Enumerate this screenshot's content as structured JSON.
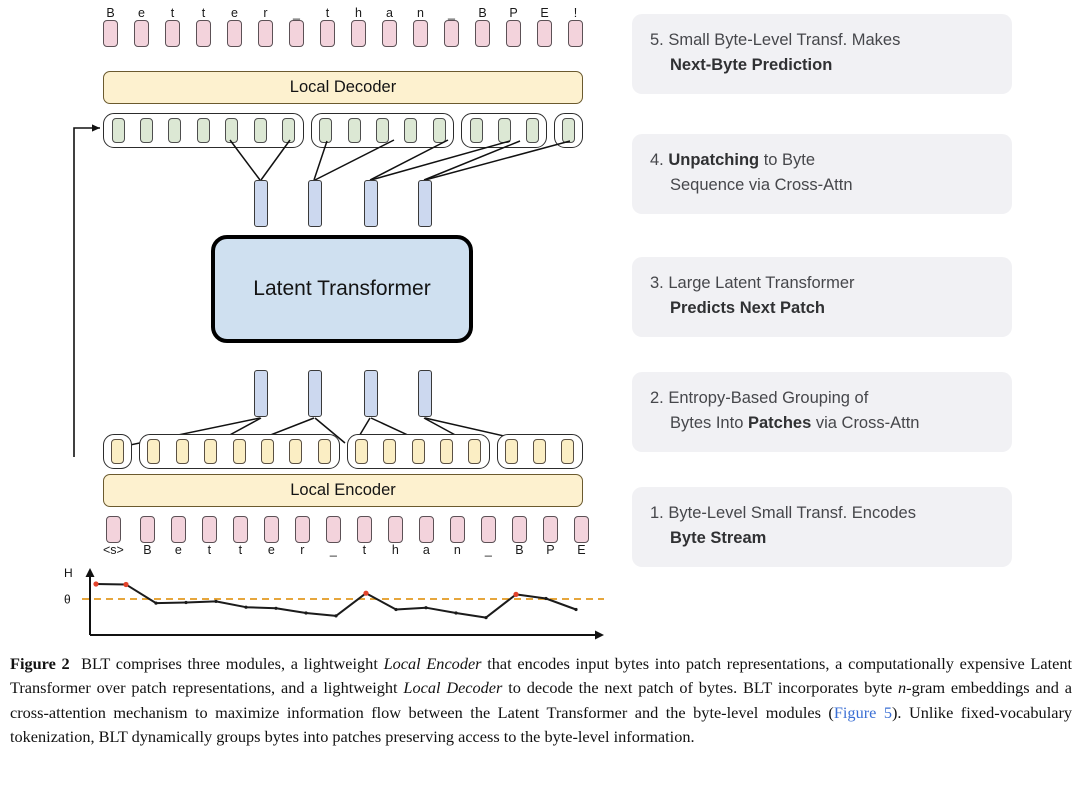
{
  "figure": {
    "label": "Figure 2",
    "caption_text": "BLT comprises three modules, a lightweight Local Encoder that encodes input bytes into patch representations, a computationally expensive Latent Transformer over patch representations, and a lightweight Local Decoder to decode the next patch of bytes. BLT incorporates byte n-gram embeddings and a cross-attention mechanism to maximize information flow between the Latent Transformer and the byte-level modules (Figure 5). Unlike fixed-vocabulary tokenization, BLT dynamically groups bytes into patches preserving access to the byte-level information.",
    "caption_parts": {
      "p1": "BLT comprises three modules, a lightweight ",
      "i1": "Local Encoder",
      "p2": " that encodes input bytes into patch representations, a computationally expensive Latent Transformer over patch representations, and a lightweight ",
      "i2": "Local Decoder",
      "p3": " to decode the next patch of bytes. BLT incorporates byte ",
      "i3": "n",
      "p4": "-gram embeddings and a cross-attention mechanism to maximize information flow between the Latent Transformer and the byte-level modules (",
      "link": "Figure 5",
      "p5": "). Unlike fixed-vocabulary tokenization, BLT dynamically groups bytes into patches preserving access to the byte-level information."
    }
  },
  "modules": {
    "local_decoder": "Local Decoder",
    "latent_transformer": "Latent Transformer",
    "local_encoder": "Local Encoder"
  },
  "output_bytes": {
    "labels": [
      "B",
      "e",
      "t",
      "t",
      "e",
      "r",
      "_",
      "t",
      "h",
      "a",
      "n",
      "_",
      "B",
      "P",
      "E",
      "!"
    ],
    "count": 16,
    "color": "#f3d3dc"
  },
  "input_bytes": {
    "labels": [
      "<s>",
      "B",
      "e",
      "t",
      "t",
      "e",
      "r",
      "_",
      "t",
      "h",
      "a",
      "n",
      "_",
      "B",
      "P",
      "E"
    ],
    "count": 16,
    "color": "#f3d3dc"
  },
  "decoder_patches": {
    "group_sizes": [
      7,
      5,
      3,
      1
    ],
    "color": "#dce8d4"
  },
  "encoder_patches": {
    "group_sizes": [
      1,
      7,
      5,
      3
    ],
    "color": "#fbeec4"
  },
  "patch_vectors": {
    "count_top": 4,
    "count_bottom": 4,
    "color": "#ccd8ef"
  },
  "steps": [
    {
      "number": "5.",
      "line1_plain": "Small Byte-Level Transf. Makes",
      "line2_bold": "Next-Byte Prediction"
    },
    {
      "number": "4.",
      "line1_bold": "Unpatching",
      "line1_plain": " to Byte",
      "line2_plain": "Sequence via Cross-Attn"
    },
    {
      "number": "3.",
      "line1_plain": "Large Latent Transformer",
      "line2_bold": "Predicts Next Patch"
    },
    {
      "number": "2.",
      "line1_plain": "Entropy-Based Grouping of",
      "line2_pre": "Bytes Into ",
      "line2_bold": "Patches",
      "line2_post": " via Cross-Attn"
    },
    {
      "number": "1.",
      "line1_plain": "Byte-Level  Small Transf. Encodes",
      "line2_bold": "Byte Stream"
    }
  ],
  "chart_data": {
    "type": "line",
    "title": "",
    "ylabel": "H",
    "xlabel": "",
    "threshold_label": "θ",
    "threshold_value": 0.62,
    "threshold_color": "#e6a63c",
    "line_color": "#1b1b1b",
    "marker_color": "#e2422a",
    "grid": false,
    "x": [
      0,
      1,
      2,
      3,
      4,
      5,
      6,
      7,
      8,
      9,
      10,
      11,
      12,
      13,
      14,
      15
    ],
    "xtick_labels": [
      "<s>",
      "B",
      "e",
      "t",
      "t",
      "e",
      "r",
      "_",
      "t",
      "h",
      "a",
      "n",
      "_",
      "B",
      "P",
      "E"
    ],
    "values": [
      0.88,
      0.87,
      0.55,
      0.56,
      0.58,
      0.48,
      0.46,
      0.38,
      0.33,
      0.72,
      0.44,
      0.47,
      0.38,
      0.3,
      0.7,
      0.63,
      0.44
    ],
    "above_threshold_indices": [
      0,
      1,
      9,
      14
    ],
    "ylim": [
      0,
      1
    ],
    "legend": "none"
  }
}
